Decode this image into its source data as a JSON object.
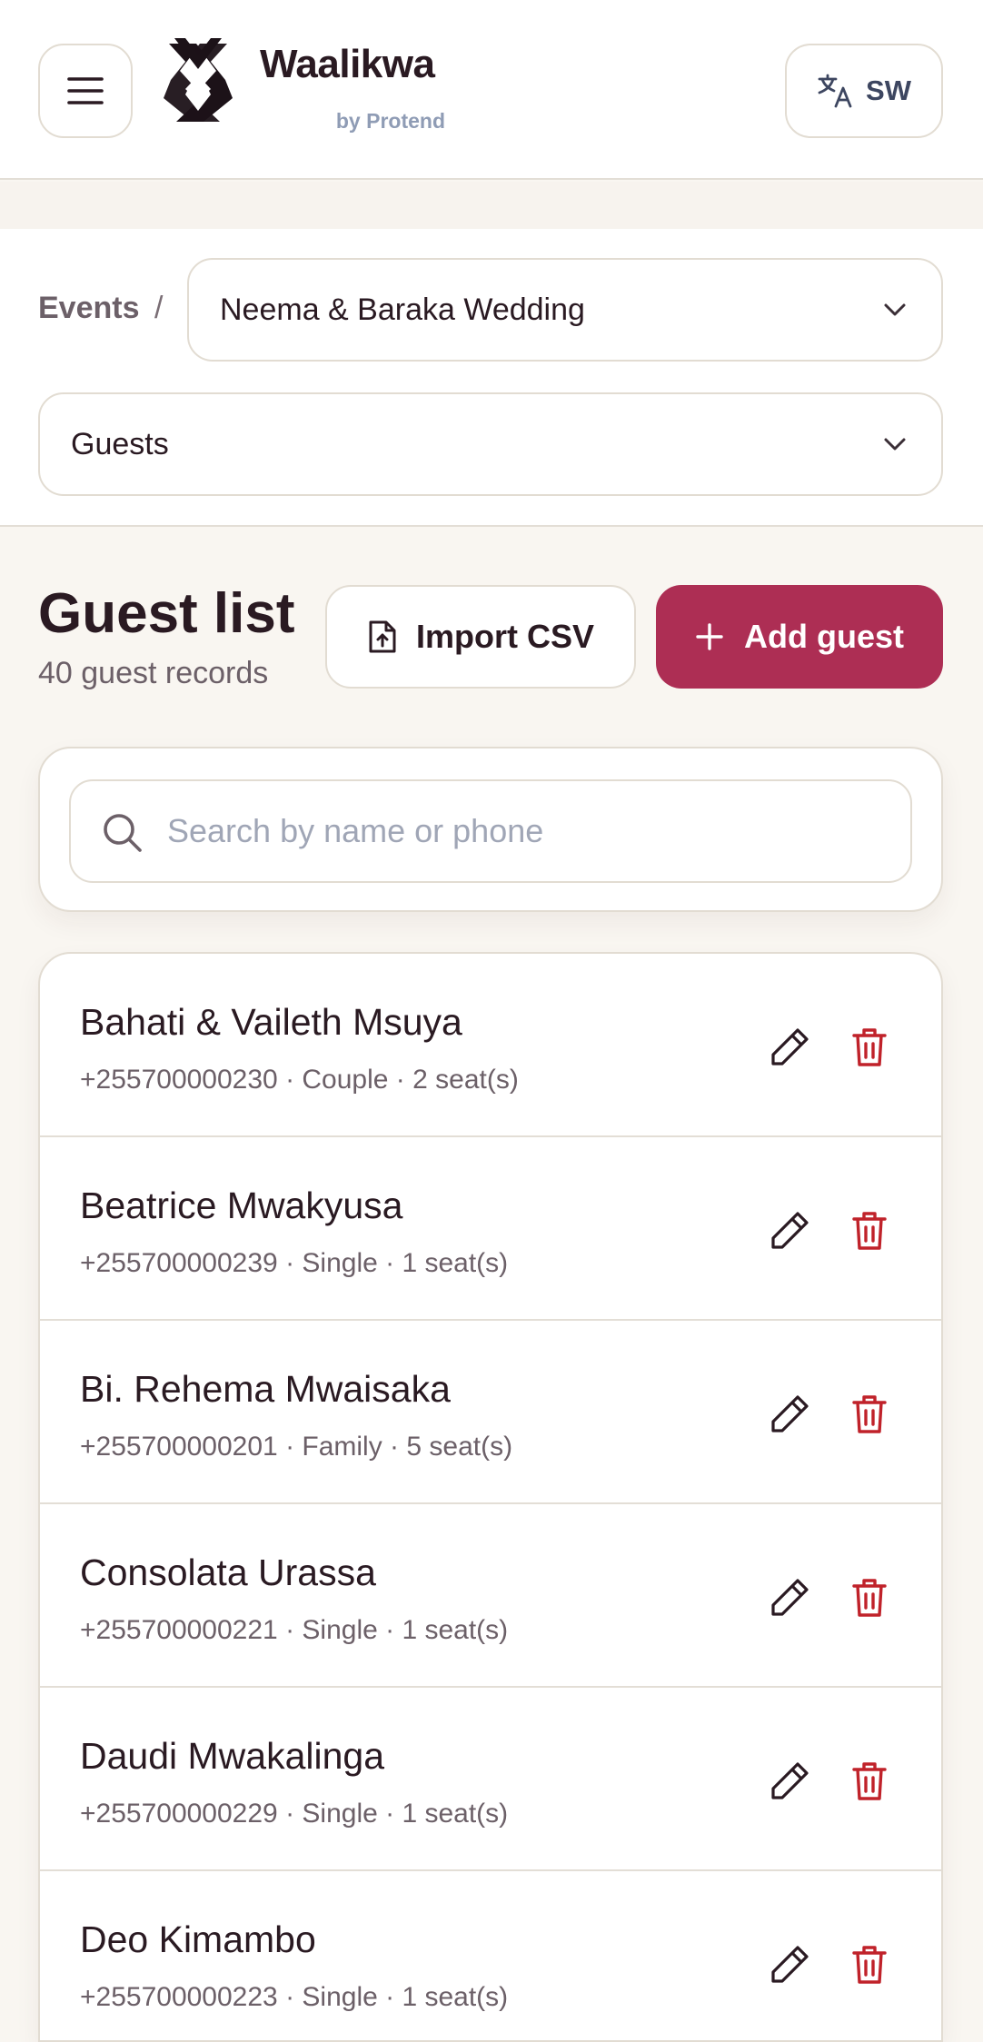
{
  "header": {
    "brand_name": "Waalikwa",
    "brand_sub": "by Protend",
    "language_label": "SW"
  },
  "breadcrumb": {
    "root": "Events",
    "separator": "/"
  },
  "event_select": {
    "value": "Neema & Baraka Wedding"
  },
  "section_select": {
    "value": "Guests"
  },
  "guest_list": {
    "title": "Guest list",
    "subtitle": "40 guest records",
    "import_label": "Import CSV",
    "add_label": "Add guest"
  },
  "search": {
    "placeholder": "Search by name or phone"
  },
  "guests": [
    {
      "name": "Bahati & Vaileth Msuya",
      "meta": "+255700000230 · Couple · 2 seat(s)"
    },
    {
      "name": "Beatrice Mwakyusa",
      "meta": "+255700000239 · Single · 1 seat(s)"
    },
    {
      "name": "Bi. Rehema Mwaisaka",
      "meta": "+255700000201 · Family · 5 seat(s)"
    },
    {
      "name": "Consolata Urassa",
      "meta": "+255700000221 · Single · 1 seat(s)"
    },
    {
      "name": "Daudi Mwakalinga",
      "meta": "+255700000229 · Single · 1 seat(s)"
    },
    {
      "name": "Deo Kimambo",
      "meta": "+255700000223 · Single · 1 seat(s)"
    }
  ],
  "colors": {
    "accent": "#ad2e54",
    "delete": "#c0222a",
    "background": "#f9f6f1"
  },
  "icons": {
    "menu": "menu-icon",
    "logo": "logo-mark",
    "language": "translate-icon",
    "chevron": "chevron-down-icon",
    "import": "file-upload-icon",
    "add": "plus-icon",
    "search": "search-icon",
    "edit": "pencil-icon",
    "delete": "trash-icon"
  }
}
